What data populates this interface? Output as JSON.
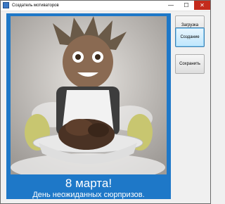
{
  "window": {
    "title": "Создатель мотиваторов",
    "minimize_glyph": "—",
    "maximize_glyph": "☐",
    "close_glyph": "✕"
  },
  "buttons": {
    "load_label": "Загрузка",
    "create_label": "Создание",
    "save_label": "Сохранить"
  },
  "poster": {
    "title": "8 марта!",
    "subtitle": "День неожиданных сюрпризов.",
    "frame_color": "#1e78c8",
    "text_color": "#ffffff"
  },
  "icons": {
    "app": "app-icon"
  }
}
